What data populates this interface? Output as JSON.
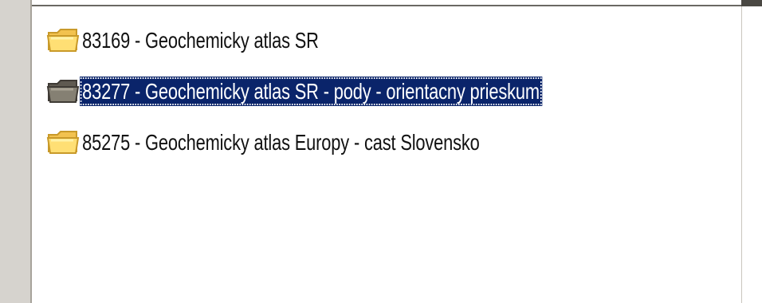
{
  "tree": {
    "items": [
      {
        "label": "83169 - Geochemicky atlas SR",
        "icon": "folder-icon",
        "selected": false
      },
      {
        "label": "83277 - Geochemicky atlas SR - pody - orientacny prieskum",
        "icon": "folder-selected-icon",
        "selected": true
      },
      {
        "label": "85275 - Geochemicky atlas Europy - cast Slovensko",
        "icon": "folder-icon",
        "selected": false
      }
    ]
  },
  "colors": {
    "selection_background": "#0a246a",
    "folder_yellow": "#f7cf55",
    "folder_selected_gray": "#777064",
    "gutter": "#d6d3ce"
  }
}
